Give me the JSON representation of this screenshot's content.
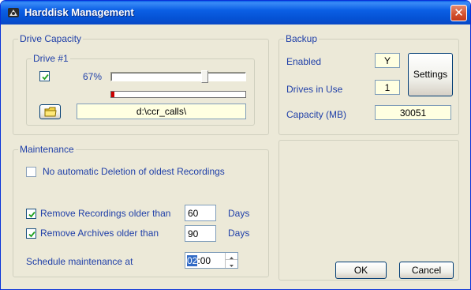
{
  "window": {
    "title": "Harddisk Management",
    "close_glyph": "✕"
  },
  "drive_capacity": {
    "group_label": "Drive Capacity",
    "drive": {
      "group_label": "Drive #1",
      "checked": true,
      "percent_label": "67%",
      "slider_value": 0.67,
      "usage_fill": 0.02,
      "usage_color": "#cc0000",
      "path": "d:\\ccr_calls\\",
      "folder_icon": "folder-icon"
    }
  },
  "backup": {
    "group_label": "Backup",
    "enabled_label": "Enabled",
    "enabled_value": "Y",
    "drives_label": "Drives in Use",
    "drives_value": "1",
    "settings_button": "Settings",
    "capacity_label": "Capacity (MB)",
    "capacity_value": "30051"
  },
  "maintenance": {
    "group_label": "Maintenance",
    "no_delete_label": "No automatic Deletion of oldest Recordings",
    "no_delete_checked": false,
    "remove_recordings_label": "Remove Recordings older than",
    "remove_recordings_checked": true,
    "remove_recordings_value": "60",
    "remove_recordings_unit": "Days",
    "remove_archives_label": "Remove Archives older than",
    "remove_archives_checked": true,
    "remove_archives_value": "90",
    "remove_archives_unit": "Days",
    "schedule_label": "Schedule maintenance at",
    "schedule_hour": "02",
    "schedule_rest": ":00"
  },
  "buttons": {
    "ok": "OK",
    "cancel": "Cancel"
  },
  "colors": {
    "accent": "#1f3fa8",
    "titlebar": "#0552d4",
    "highlight": "#316ac5"
  }
}
